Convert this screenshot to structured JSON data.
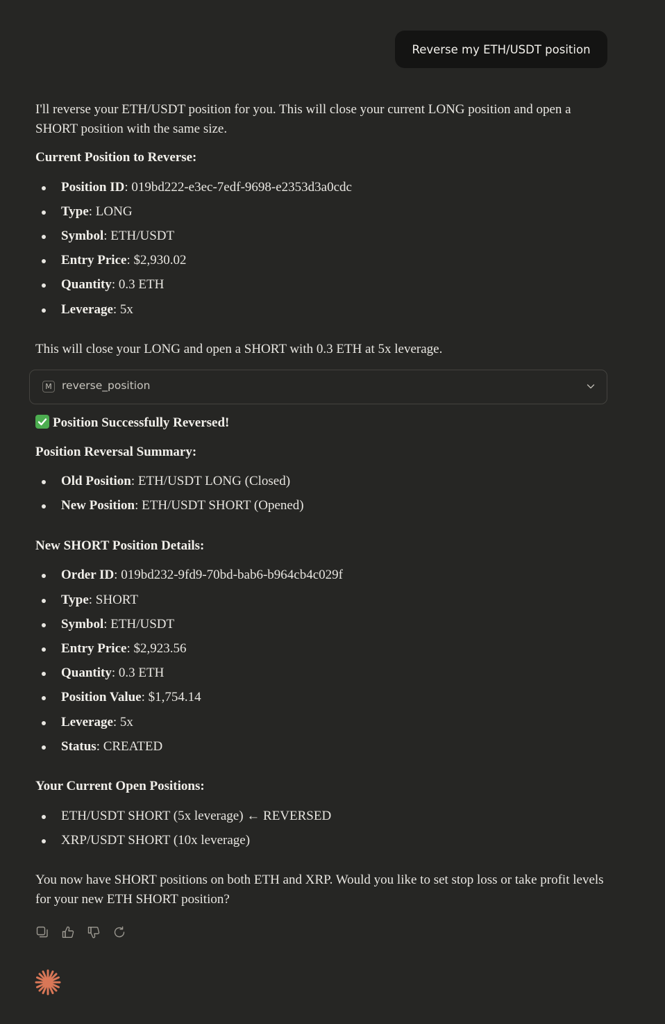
{
  "user_message": "Reverse my ETH/USDT position",
  "response": {
    "intro": "I'll reverse your ETH/USDT position for you. This will close your current LONG position and open a SHORT position with the same size.",
    "current_heading": "Current Position to Reverse:",
    "current_items": [
      {
        "label": "Position ID",
        "value": ": 019bd222-e3ec-7edf-9698-e2353d3a0cdc"
      },
      {
        "label": "Type",
        "value": ": LONG"
      },
      {
        "label": "Symbol",
        "value": ": ETH/USDT"
      },
      {
        "label": "Entry Price",
        "value": ": $2,930.02"
      },
      {
        "label": "Quantity",
        "value": ": 0.3 ETH"
      },
      {
        "label": "Leverage",
        "value": ": 5x"
      }
    ],
    "close_note": "This will close your LONG and open a SHORT with 0.3 ETH at 5x leverage.",
    "tool": {
      "badge": "M",
      "name": "reverse_position",
      "icon": "chevron-down-icon"
    },
    "success_title": "Position Successfully Reversed!",
    "summary_heading": "Position Reversal Summary:",
    "summary_items": [
      {
        "label": "Old Position",
        "value": ": ETH/USDT LONG (Closed)"
      },
      {
        "label": "New Position",
        "value": ": ETH/USDT SHORT (Opened)"
      }
    ],
    "details_heading": "New SHORT Position Details:",
    "details_items": [
      {
        "label": "Order ID",
        "value": ": 019bd232-9fd9-70bd-bab6-b964cb4c029f"
      },
      {
        "label": "Type",
        "value": ": SHORT"
      },
      {
        "label": "Symbol",
        "value": ": ETH/USDT"
      },
      {
        "label": "Entry Price",
        "value": ": $2,923.56"
      },
      {
        "label": "Quantity",
        "value": ": 0.3 ETH"
      },
      {
        "label": "Position Value",
        "value": ": $1,754.14"
      },
      {
        "label": "Leverage",
        "value": ": 5x"
      },
      {
        "label": "Status",
        "value": ": CREATED"
      }
    ],
    "open_heading": "Your Current Open Positions:",
    "open_items": [
      "ETH/USDT SHORT (5x leverage) ← REVERSED",
      "XRP/USDT SHORT (10x leverage)"
    ],
    "closing": "You now have SHORT positions on both ETH and XRP. Would you like to set stop loss or take profit levels for your new ETH SHORT position?"
  },
  "actions": [
    "copy-icon",
    "thumbs-up-icon",
    "thumbs-down-icon",
    "retry-icon"
  ],
  "colors": {
    "background": "#262624",
    "bubble": "#141413",
    "text": "#e8e6e1",
    "accent_logo": "#d97757",
    "success": "#4cad50"
  }
}
